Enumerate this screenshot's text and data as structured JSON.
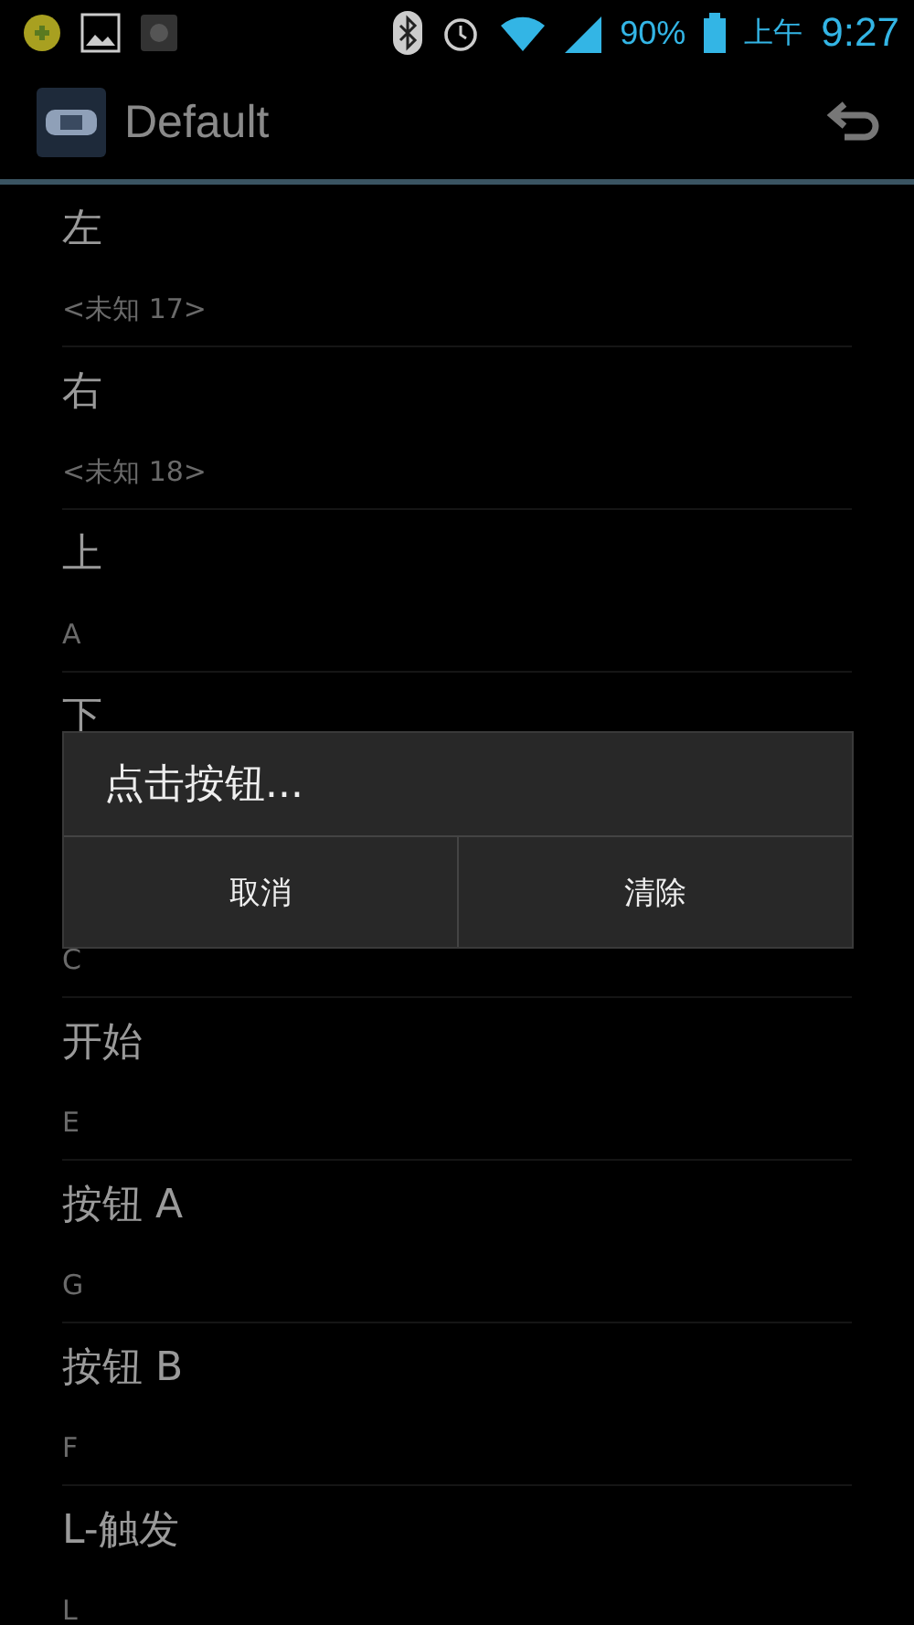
{
  "status_bar": {
    "battery": "90%",
    "am_pm": "上午",
    "time": "9:27"
  },
  "action_bar": {
    "title": "Default"
  },
  "list": [
    {
      "title": "左",
      "value": "<未知 17>"
    },
    {
      "title": "右",
      "value": "<未知 18>"
    },
    {
      "title": "上",
      "value": "A"
    },
    {
      "title": "下"
    },
    {
      "value": "C"
    },
    {
      "title": "开始",
      "value": "E"
    },
    {
      "title": "按钮 A",
      "value": "G"
    },
    {
      "title": "按钮 B",
      "value": "F"
    },
    {
      "title": "L-触发",
      "value": "L"
    }
  ],
  "dialog": {
    "title": "点击按钮...",
    "buttons": [
      "取消",
      "清除"
    ]
  }
}
